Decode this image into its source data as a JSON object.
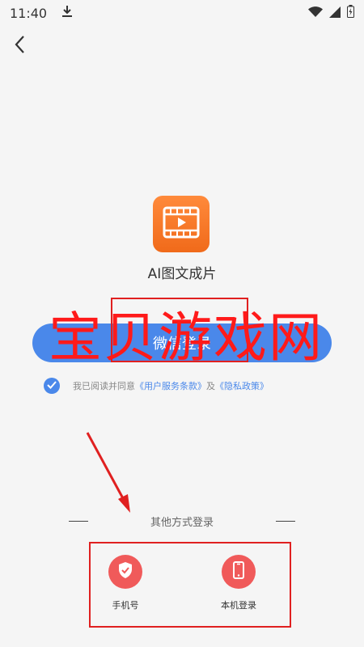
{
  "status_bar": {
    "time": "11:40",
    "icons": [
      "download-icon",
      "wifi-icon",
      "signal-icon",
      "battery-icon"
    ]
  },
  "nav": {
    "back_icon": "chevron-left-icon"
  },
  "app": {
    "name": "AI图文成片",
    "icon": "film-play-icon"
  },
  "wechat_login": {
    "label": "微信登录"
  },
  "watermark": {
    "text": "宝贝游戏网"
  },
  "agreement": {
    "prefix": "我已阅读并同意",
    "user_terms": "《用户服务条款》",
    "conjunction": "及",
    "privacy_policy": "《隐私政策》",
    "checked": true
  },
  "other_login": {
    "divider_text": "其他方式登录",
    "options": [
      {
        "label": "手机号",
        "icon": "shield-check-icon"
      },
      {
        "label": "本机登录",
        "icon": "phone-icon"
      }
    ]
  },
  "colors": {
    "primary": "#4a88ea",
    "app_icon": "#f47a2a",
    "option_icon": "#f05a5a",
    "annotation": "#e02020",
    "background": "#f5f5f5"
  }
}
